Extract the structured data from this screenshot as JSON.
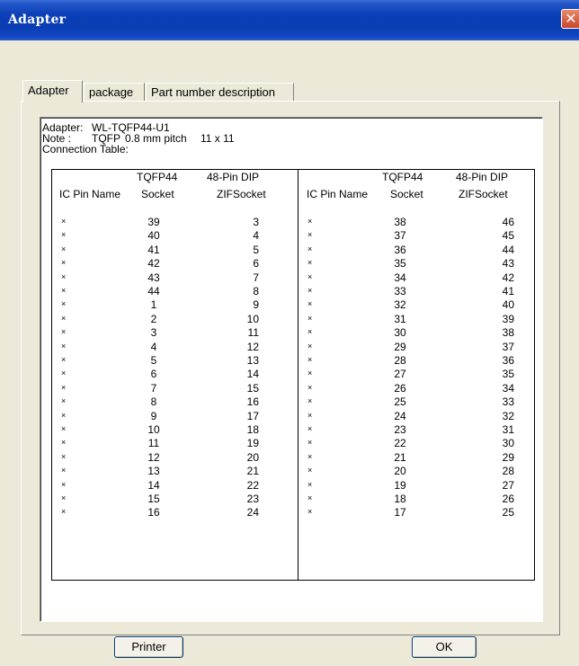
{
  "window": {
    "title": "Adapter",
    "close_symbol": "✕"
  },
  "tabs": [
    {
      "label": "Adapter",
      "active": true
    },
    {
      "label": "package",
      "active": false
    },
    {
      "label": "Part number description",
      "active": false
    }
  ],
  "adapter_info": {
    "adapter_label": "Adapter:",
    "adapter_value": "WL-TQFP44-U1",
    "note_label": "Note :",
    "note_pkg": "TQFP",
    "note_pitch": "0.8 mm pitch",
    "note_size": "11 x 11",
    "table_label": "Connection Table:"
  },
  "table": {
    "headers": {
      "socket_top": "TQFP44",
      "dip_top": "48-Pin DIP",
      "pin_name": "IC Pin Name",
      "socket_bottom": "Socket",
      "dip_bottom": "ZIFSocket"
    },
    "rows": [
      {
        "n": "×",
        "ls": "39",
        "ld": "3",
        "rn": "×",
        "rs": "38",
        "rd": "46"
      },
      {
        "n": "×",
        "ls": "40",
        "ld": "4",
        "rn": "×",
        "rs": "37",
        "rd": "45"
      },
      {
        "n": "×",
        "ls": "41",
        "ld": "5",
        "rn": "×",
        "rs": "36",
        "rd": "44"
      },
      {
        "n": "×",
        "ls": "42",
        "ld": "6",
        "rn": "×",
        "rs": "35",
        "rd": "43"
      },
      {
        "n": "×",
        "ls": "43",
        "ld": "7",
        "rn": "×",
        "rs": "34",
        "rd": "42"
      },
      {
        "n": "×",
        "ls": "44",
        "ld": "8",
        "rn": "×",
        "rs": "33",
        "rd": "41"
      },
      {
        "n": "×",
        "ls": "1",
        "ld": "9",
        "rn": "×",
        "rs": "32",
        "rd": "40"
      },
      {
        "n": "×",
        "ls": "2",
        "ld": "10",
        "rn": "×",
        "rs": "31",
        "rd": "39"
      },
      {
        "n": "×",
        "ls": "3",
        "ld": "11",
        "rn": "×",
        "rs": "30",
        "rd": "38"
      },
      {
        "n": "×",
        "ls": "4",
        "ld": "12",
        "rn": "×",
        "rs": "29",
        "rd": "37"
      },
      {
        "n": "×",
        "ls": "5",
        "ld": "13",
        "rn": "×",
        "rs": "28",
        "rd": "36"
      },
      {
        "n": "×",
        "ls": "6",
        "ld": "14",
        "rn": "×",
        "rs": "27",
        "rd": "35"
      },
      {
        "n": "×",
        "ls": "7",
        "ld": "15",
        "rn": "×",
        "rs": "26",
        "rd": "34"
      },
      {
        "n": "×",
        "ls": "8",
        "ld": "16",
        "rn": "×",
        "rs": "25",
        "rd": "33"
      },
      {
        "n": "×",
        "ls": "9",
        "ld": "17",
        "rn": "×",
        "rs": "24",
        "rd": "32"
      },
      {
        "n": "×",
        "ls": "10",
        "ld": "18",
        "rn": "×",
        "rs": "23",
        "rd": "31"
      },
      {
        "n": "×",
        "ls": "11",
        "ld": "19",
        "rn": "×",
        "rs": "22",
        "rd": "30"
      },
      {
        "n": "×",
        "ls": "12",
        "ld": "20",
        "rn": "×",
        "rs": "21",
        "rd": "29"
      },
      {
        "n": "×",
        "ls": "13",
        "ld": "21",
        "rn": "×",
        "rs": "20",
        "rd": "28"
      },
      {
        "n": "×",
        "ls": "14",
        "ld": "22",
        "rn": "×",
        "rs": "19",
        "rd": "27"
      },
      {
        "n": "×",
        "ls": "15",
        "ld": "23",
        "rn": "×",
        "rs": "18",
        "rd": "26"
      },
      {
        "n": "×",
        "ls": "16",
        "ld": "24",
        "rn": "×",
        "rs": "17",
        "rd": "25"
      }
    ]
  },
  "buttons": {
    "printer": "Printer",
    "ok": "OK"
  }
}
